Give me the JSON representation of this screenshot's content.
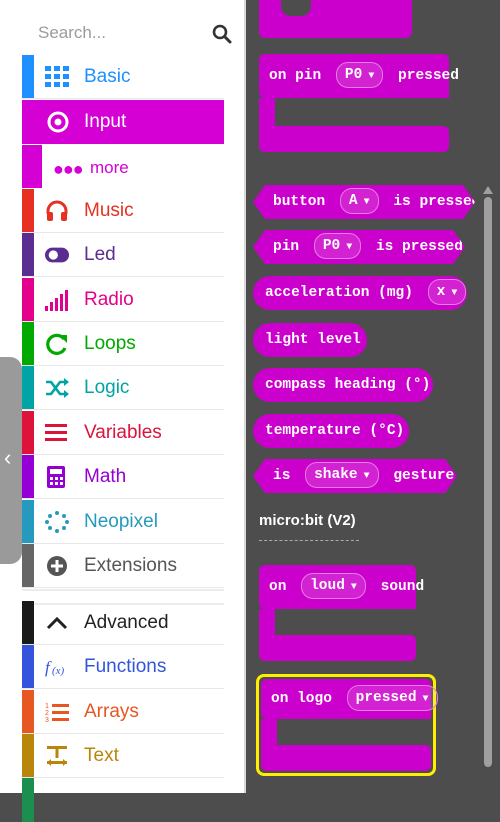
{
  "search": {
    "placeholder": "Search..."
  },
  "categories": [
    {
      "label": "Basic",
      "color": "#1e90ff",
      "icon": "grid-icon"
    },
    {
      "label": "Input",
      "color": "#d400d4",
      "icon": "target-icon"
    },
    {
      "label": "Music",
      "color": "#e63022",
      "icon": "headphones-icon"
    },
    {
      "label": "Led",
      "color": "#5c2d91",
      "icon": "toggle-icon"
    },
    {
      "label": "Radio",
      "color": "#e3008c",
      "icon": "signal-bars-icon"
    },
    {
      "label": "Loops",
      "color": "#00aa00",
      "icon": "refresh-icon"
    },
    {
      "label": "Logic",
      "color": "#00a4a6",
      "icon": "shuffle-icon"
    },
    {
      "label": "Variables",
      "color": "#dc143c",
      "icon": "list-lines-icon"
    },
    {
      "label": "Math",
      "color": "#9400d3",
      "icon": "calculator-icon"
    },
    {
      "label": "Neopixel",
      "color": "#2699bf",
      "icon": "dot-circle-icon"
    },
    {
      "label": "Extensions",
      "color": "#666666",
      "icon": "plus-circle-icon"
    },
    {
      "label": "Advanced",
      "color": "#000000",
      "icon": "chevron-up-icon"
    },
    {
      "label": "Functions",
      "color": "#3455db",
      "icon": "function-icon"
    },
    {
      "label": "Arrays",
      "color": "#e65722",
      "icon": "numbered-list-icon"
    },
    {
      "label": "Text",
      "color": "#b8860b",
      "icon": "text-format-icon"
    }
  ],
  "more": {
    "label": "more"
  },
  "blocks": {
    "on_pin_pressed": {
      "prefix": "on pin",
      "dropdown": "P0",
      "suffix": "pressed"
    },
    "button_is_pressed": {
      "prefix": "button",
      "dropdown": "A",
      "suffix": "is pressed"
    },
    "pin_is_pressed": {
      "prefix": "pin",
      "dropdown": "P0",
      "suffix": "is pressed"
    },
    "acceleration": {
      "prefix": "acceleration (mg)",
      "dropdown": "x"
    },
    "light_level": "light level",
    "compass_heading": "compass heading (°)",
    "temperature": "temperature (°C)",
    "is_gesture": {
      "prefix": "is",
      "dropdown": "shake",
      "suffix": "gesture"
    },
    "v2_heading": "micro:bit (V2)",
    "on_loud_sound": {
      "prefix": "on",
      "dropdown": "loud",
      "suffix": "sound"
    },
    "on_logo_pressed": {
      "prefix": "on logo",
      "dropdown": "pressed"
    }
  },
  "colors": {
    "input": "#cc00cc",
    "highlight": "#ffee00",
    "workspace": "#4d4d4d"
  }
}
